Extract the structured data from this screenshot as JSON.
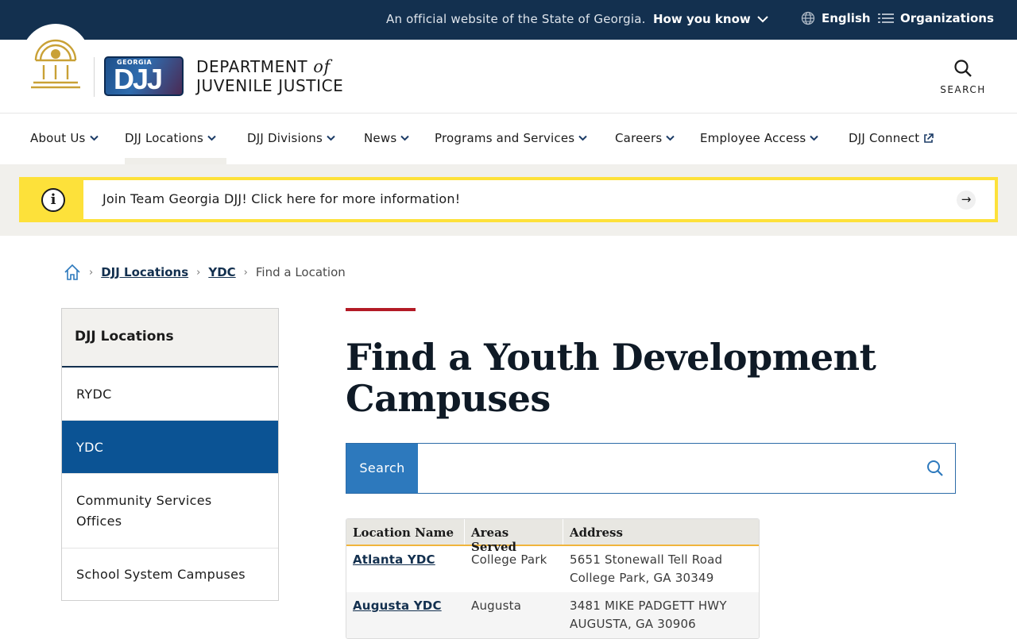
{
  "topbar": {
    "official_text": "An official website of the State of Georgia.",
    "how_you_know": "How you know",
    "language": "English",
    "organizations": "Organizations"
  },
  "header": {
    "logo_small_text": "GEORGIA",
    "logo_text": "DJJ",
    "dept_line1": "DEPARTMENT",
    "dept_of": "of",
    "dept_line2": "JUVENILE JUSTICE",
    "search_label": "SEARCH"
  },
  "nav": {
    "items": [
      {
        "label": "About Us"
      },
      {
        "label": "DJJ Locations"
      },
      {
        "label": "DJJ Divisions"
      },
      {
        "label": "News"
      },
      {
        "label": "Programs and Services"
      },
      {
        "label": "Careers"
      },
      {
        "label": "Employee Access"
      },
      {
        "label": "DJJ Connect"
      }
    ]
  },
  "alert": {
    "icon": "info-icon",
    "message": "Join Team Georgia DJJ! Click here for more information!"
  },
  "breadcrumb": {
    "items": [
      "DJJ Locations",
      "YDC"
    ],
    "current": "Find a Location"
  },
  "sidenav": {
    "heading": "DJJ Locations",
    "items": [
      {
        "label": "RYDC"
      },
      {
        "label": "YDC"
      },
      {
        "label": "Community Services Offices"
      },
      {
        "label": "School System Campuses"
      }
    ],
    "active": "YDC"
  },
  "main": {
    "title": "Find a Youth Development Campuses",
    "search_label": "Search",
    "search_value": ""
  },
  "table": {
    "headers": [
      "Location Name",
      "Areas Served",
      "Address"
    ],
    "rows": [
      {
        "name": "Atlanta YDC",
        "area": "College Park",
        "addr1": "5651 Stonewall Tell Road",
        "addr2": "College Park, GA 30349"
      },
      {
        "name": "Augusta YDC",
        "area": "Augusta",
        "addr1": "3481 MIKE PADGETT HWY",
        "addr2": "AUGUSTA, GA 30906"
      }
    ]
  },
  "colors": {
    "topbar_bg": "#13304f",
    "alert_yellow": "#fde13a",
    "active_blue": "#0b5394",
    "accent_red": "#b31b26",
    "search_label_bg": "#2d79bd"
  }
}
